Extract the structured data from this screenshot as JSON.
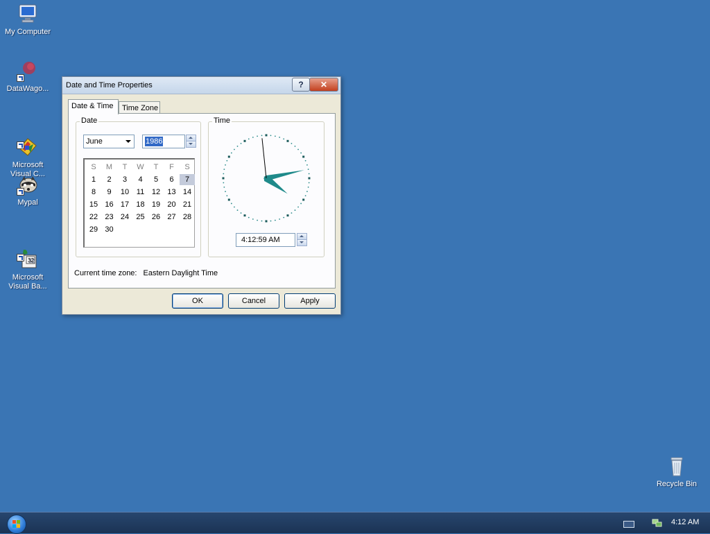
{
  "desktop": {
    "icons": [
      {
        "label": "My Computer"
      },
      {
        "label": "DataWago..."
      },
      {
        "label": "Microsoft\nVisual C..."
      },
      {
        "label": "Mypal"
      },
      {
        "label": "Microsoft\nVisual Ba..."
      },
      {
        "label": "Recycle Bin"
      }
    ]
  },
  "dialog": {
    "title": "Date and Time Properties",
    "help_glyph": "?",
    "close_glyph": "✕",
    "tabs": [
      {
        "label": "Date & Time",
        "active": true
      },
      {
        "label": "Time Zone",
        "active": false
      }
    ],
    "date_group": {
      "label": "Date",
      "month": "June",
      "year": "1986",
      "weekday_headers": [
        "S",
        "M",
        "T",
        "W",
        "T",
        "F",
        "S"
      ],
      "days": [
        "1",
        "2",
        "3",
        "4",
        "5",
        "6",
        "7",
        "8",
        "9",
        "10",
        "11",
        "12",
        "13",
        "14",
        "15",
        "16",
        "17",
        "18",
        "19",
        "20",
        "21",
        "22",
        "23",
        "24",
        "25",
        "26",
        "27",
        "28",
        "29",
        "30"
      ],
      "first_weekday_index": 0,
      "selected_day": "7"
    },
    "time_group": {
      "label": "Time",
      "time_value": "4:12:59 AM",
      "clock": {
        "hour": 4,
        "minute": 12,
        "second": 59
      }
    },
    "timezone": {
      "label": "Current time zone:",
      "value": "Eastern Daylight Time"
    },
    "buttons": {
      "ok": "OK",
      "cancel": "Cancel",
      "apply": "Apply"
    }
  },
  "taskbar": {
    "clock": "4:12 AM"
  },
  "colors": {
    "desktop": "#3a75b4",
    "clock_hands": "#1f8a8a",
    "selection": "#3169c6"
  }
}
